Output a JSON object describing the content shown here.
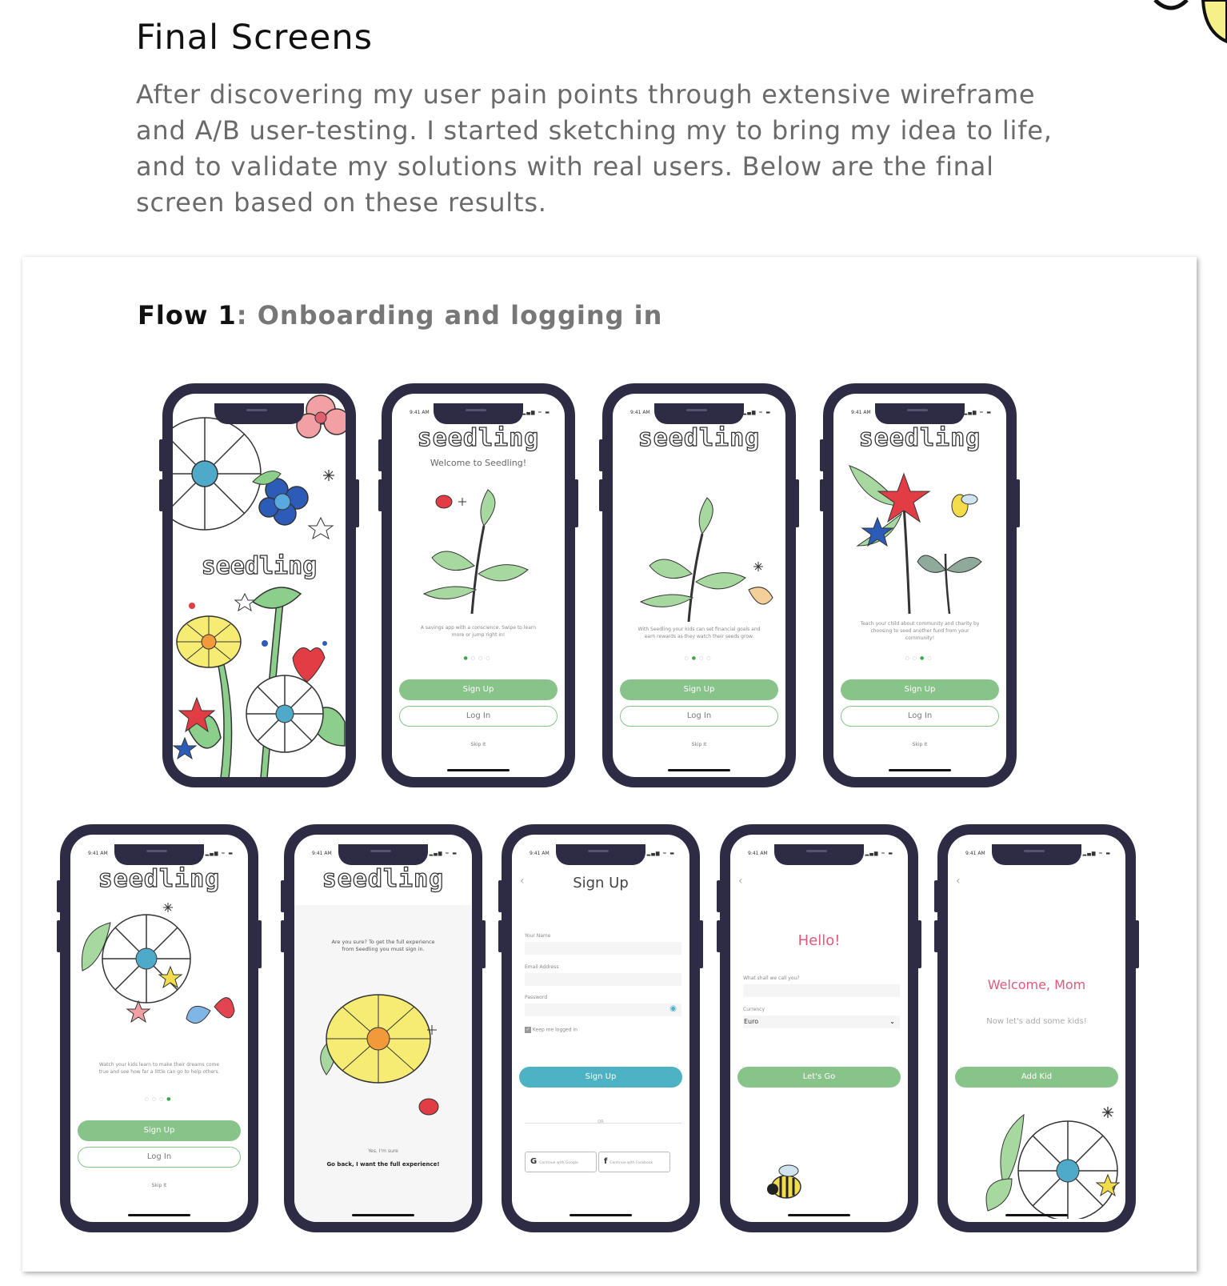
{
  "header": {
    "title": "Final Screens",
    "intro": "After discovering my user pain points through extensive wireframe and A/B user-testing. I started sketching my to bring my idea to life, and to validate my solutions with real users. Below are the final screen based on these results."
  },
  "flow": {
    "label": "Flow 1",
    "separator": ": ",
    "name": "Onboarding and logging in"
  },
  "status": {
    "time": "9:41 AM",
    "icons": "▂▄▆ ≈ ▬"
  },
  "app": {
    "logo": "seedling",
    "welcome": "Welcome to Seedling!",
    "signup": "Sign Up",
    "login": "Log In",
    "skip": "Skip It",
    "dots": "● ● ● ●"
  },
  "screens": {
    "s2": {
      "caption": "A savings app with a conscience. Swipe to learn more or jump right in!"
    },
    "s3": {
      "caption": "With Seedling your kids can set financial goals and earn rewards as they watch their seeds grow."
    },
    "s4": {
      "caption": "Teach your child about community and charity by choosing to seed another fund from your community!"
    },
    "s5": {
      "caption": "Watch your kids learn to make their dreams come true and see how far a little can go to help others."
    },
    "s6": {
      "question": "Are you sure? To get the full experience from Seedling you must sign in.",
      "yes": "Yes, I'm sure",
      "goback": "Go back, I want the full experience!"
    },
    "s7": {
      "title": "Sign Up",
      "name_label": "Your Name",
      "email_label": "Email Address",
      "password_label": "Password",
      "keep_logged": "Keep me logged in",
      "submit": "Sign Up",
      "or": "OR",
      "google": "Continue with Google",
      "facebook": "Continue with Facebook"
    },
    "s8": {
      "hello": "Hello!",
      "name_q": "What shall we call you?",
      "currency_label": "Currency",
      "currency_value": "Euro",
      "cta": "Let's Go"
    },
    "s9": {
      "welcome": "Welcome, Mom",
      "sub": "Now let's add some kids!",
      "cta": "Add Kid"
    }
  },
  "colors": {
    "phone_frame": "#2e2c44",
    "primary_green": "#88c489",
    "teal": "#4db3c4",
    "pink": "#e05a7a"
  }
}
